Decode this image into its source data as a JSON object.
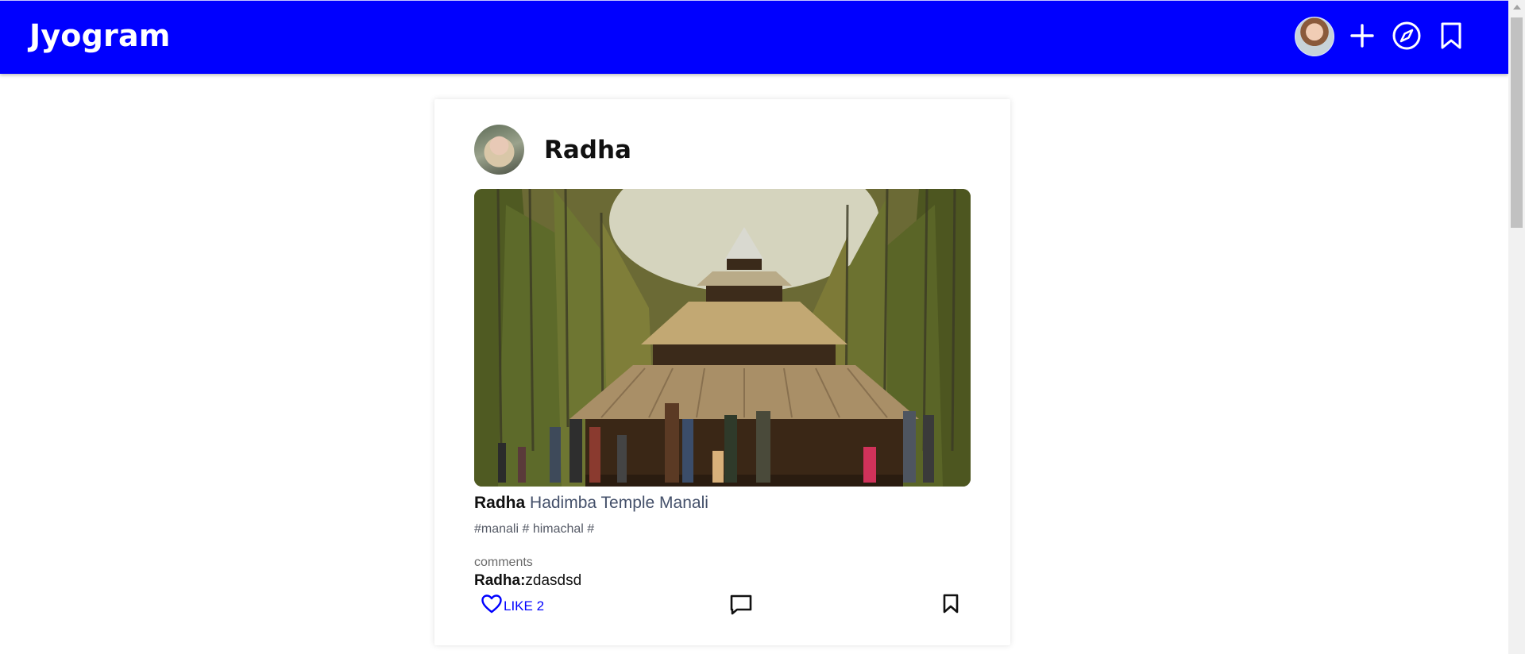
{
  "app": {
    "brand": "Jyogram",
    "brand_color": "#0000ff"
  },
  "nav": {
    "icons": [
      "avatar",
      "plus-icon",
      "compass-icon",
      "bookmark-icon"
    ]
  },
  "post": {
    "username": "Radha",
    "caption_user": "Radha",
    "caption_text": "Hadimba Temple Manali",
    "tags": "#manali # himachal #",
    "comments_label": "comments",
    "comment": {
      "user": "Radha:",
      "text": "zdasdsd"
    },
    "like_label": "LIKE 2"
  }
}
